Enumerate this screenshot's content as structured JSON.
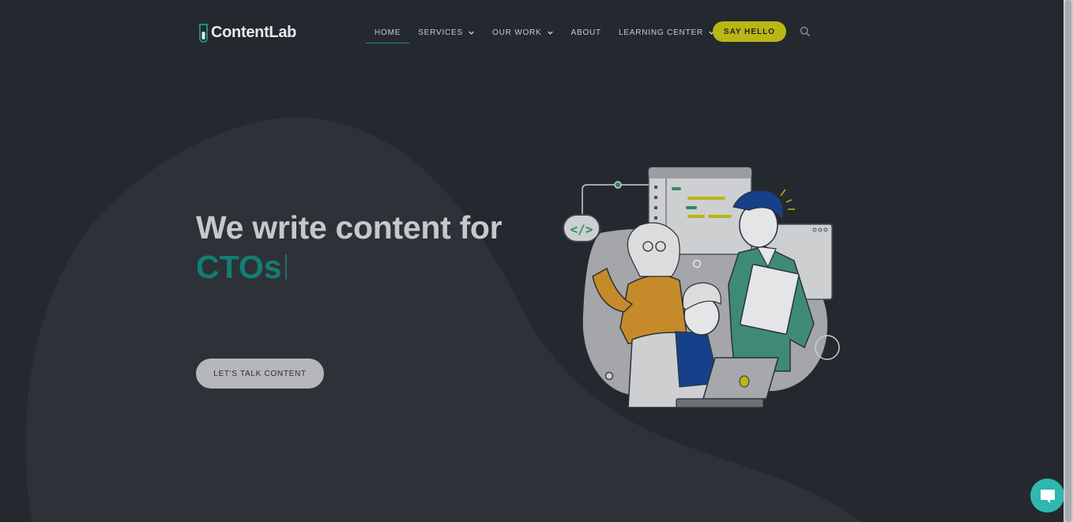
{
  "brand": {
    "name": "ContentLab"
  },
  "nav": {
    "items": [
      {
        "label": "HOME"
      },
      {
        "label": "SERVICES"
      },
      {
        "label": "OUR WORK"
      },
      {
        "label": "ABOUT"
      },
      {
        "label": "LEARNING CENTER"
      }
    ],
    "active": "HOME",
    "cta_label": "SAY HELLO",
    "search_icon": "search-icon"
  },
  "hero": {
    "title": "We write content for",
    "role": "CTOs",
    "button_label": "LET'S TALK CONTENT"
  },
  "illustration": {
    "code_badge": "</>"
  },
  "chat": {
    "icon": "chat-bubble-icon"
  },
  "colors": {
    "background": "#24292f",
    "accent_teal": "#127e74",
    "cta_yellow": "#b9b615",
    "chat_teal": "#2fb7b0"
  }
}
